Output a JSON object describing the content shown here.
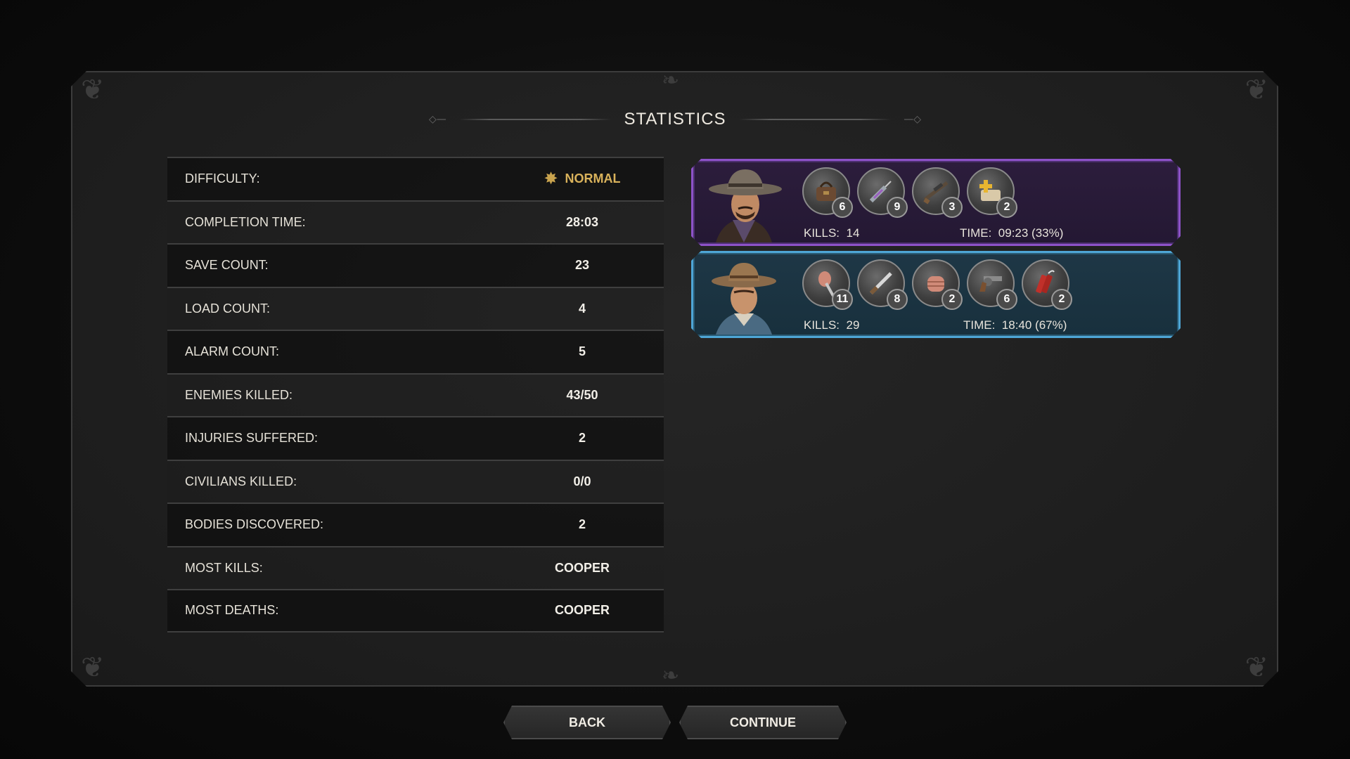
{
  "screen": {
    "title": "STATISTICS"
  },
  "stats": [
    {
      "label": "DIFFICULTY:",
      "value": "NORMAL",
      "icon": "sheriff-star-icon"
    },
    {
      "label": "COMPLETION TIME:",
      "value": "28:03"
    },
    {
      "label": "SAVE COUNT:",
      "value": "23"
    },
    {
      "label": "LOAD COUNT:",
      "value": "4"
    },
    {
      "label": "ALARM COUNT:",
      "value": "5"
    },
    {
      "label": "ENEMIES KILLED:",
      "value": "43/50"
    },
    {
      "label": "INJURIES SUFFERED:",
      "value": "2"
    },
    {
      "label": "CIVILIANS KILLED:",
      "value": "0/0"
    },
    {
      "label": "BODIES DISCOVERED:",
      "value": "2"
    },
    {
      "label": "MOST KILLS:",
      "value": "COOPER"
    },
    {
      "label": "MOST DEATHS:",
      "value": "COOPER"
    }
  ],
  "characters": [
    {
      "portrait": "grey-hat-gunslinger-portrait",
      "accent": "#8d52c8",
      "items": [
        {
          "icon": "satchel-icon",
          "count": "6"
        },
        {
          "icon": "syringe-icon",
          "count": "9"
        },
        {
          "icon": "scoped-rifle-icon",
          "count": "3"
        },
        {
          "icon": "bandage-heal-icon",
          "count": "2"
        }
      ],
      "kills_label": "KILLS:",
      "kills": "14",
      "time_label": "TIME:",
      "time": "09:23 (33%)"
    },
    {
      "portrait": "cooper-cowboy-portrait",
      "accent": "#4ea6d6",
      "items": [
        {
          "icon": "knife-stab-icon",
          "count": "11"
        },
        {
          "icon": "throwing-knife-icon",
          "count": "8"
        },
        {
          "icon": "fist-icon",
          "count": "2"
        },
        {
          "icon": "revolver-icon",
          "count": "6"
        },
        {
          "icon": "dynamite-icon",
          "count": "2"
        }
      ],
      "kills_label": "KILLS:",
      "kills": "29",
      "time_label": "TIME:",
      "time": "18:40 (67%)"
    }
  ],
  "buttons": {
    "back": "BACK",
    "continue": "CONTINUE"
  }
}
